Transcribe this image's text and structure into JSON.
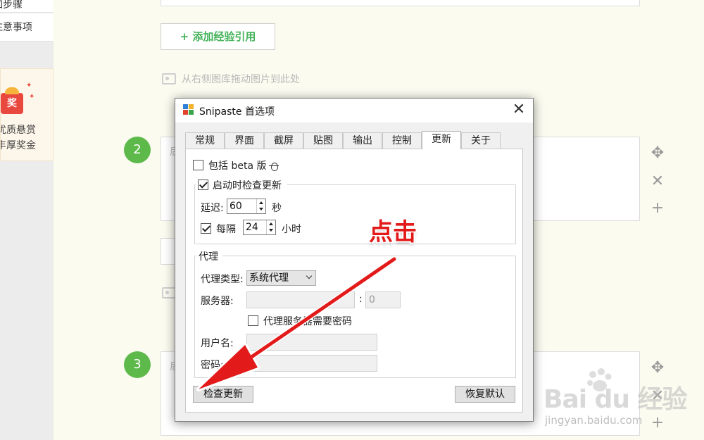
{
  "sidebar": {
    "item_a": "加步骤",
    "item_b": "注意事项",
    "promo": {
      "badge": "奖",
      "line1": "优质悬赏",
      "line2": "丰厚奖金"
    }
  },
  "content": {
    "add_reference": "+ 添加经验引用",
    "drag_hint": "从右侧图库拖动图片到此处",
    "step2": "2",
    "step3": "3",
    "placeholder_char": "后"
  },
  "dialog": {
    "title": "Snipaste 首选项",
    "tabs": [
      "常规",
      "界面",
      "截屏",
      "贴图",
      "输出",
      "控制",
      "更新",
      "关于"
    ],
    "active_tab": "更新",
    "include_beta": "包括 beta 版",
    "check_on_start": "启动时检查更新",
    "delay_label": "延迟:",
    "delay_value": "60",
    "delay_unit": "秒",
    "every_label": "每隔",
    "every_value": "24",
    "every_unit": "小时",
    "proxy_group": "代理",
    "proxy_type_label": "代理类型:",
    "proxy_type_value": "系统代理",
    "server_label": "服务器:",
    "port_sep": ":",
    "port_value": "0",
    "proxy_auth": "代理服务器需要密码",
    "username_label": "用户名:",
    "password_label": "密码:",
    "check_update_button": "检查更新",
    "restore_default_button": "恢复默认"
  },
  "annotation": {
    "text": "点击",
    "color": "#e31a1a"
  },
  "watermark": {
    "brand": "Bai du 经验",
    "site": "jingyan.baidu.com"
  },
  "colors": {
    "accent_green": "#5cb94a",
    "link_green": "#45b35a"
  }
}
